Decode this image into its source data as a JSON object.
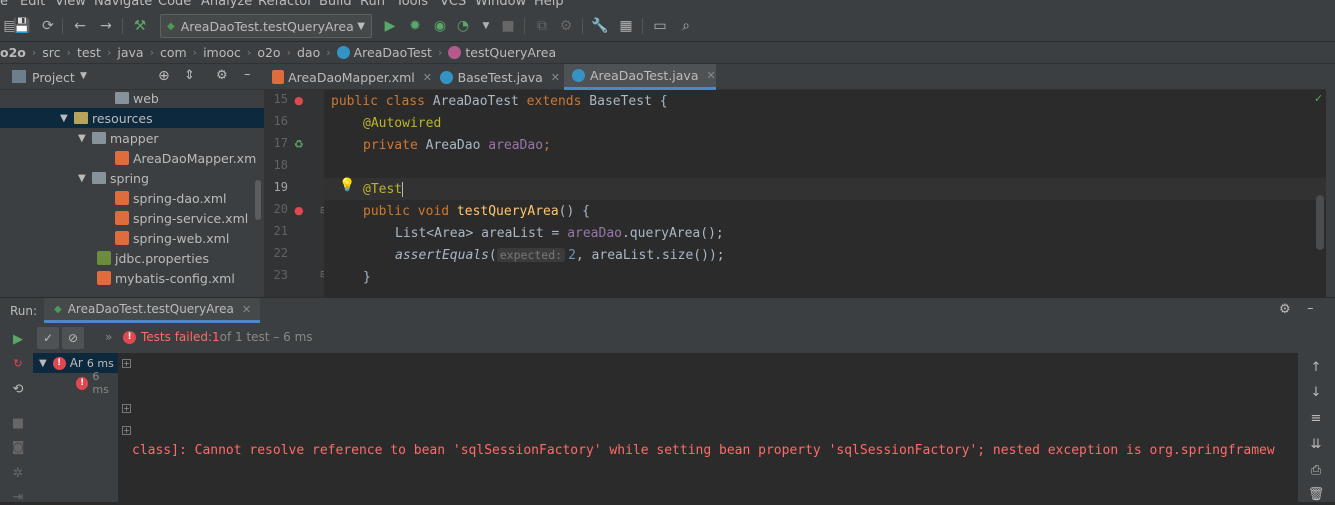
{
  "menu": [
    "e",
    "Edit",
    "View",
    "Navigate",
    "Code",
    "Analyze",
    "Refactor",
    "Build",
    "Run",
    "Tools",
    "VCS",
    "Window",
    "Help"
  ],
  "toolbar": {
    "run_config": "AreaDaoTest.testQueryArea"
  },
  "breadcrumb": [
    "o2o",
    "src",
    "test",
    "java",
    "com",
    "imooc",
    "o2o",
    "dao",
    "AreaDaoTest",
    "testQueryArea"
  ],
  "project_panel": {
    "title": "Project",
    "items": [
      {
        "label": "web",
        "type": "folder"
      },
      {
        "label": "resources",
        "type": "folder",
        "selected": true
      },
      {
        "label": "mapper",
        "type": "folder"
      },
      {
        "label": "AreaDaoMapper.xm",
        "type": "xml"
      },
      {
        "label": "spring",
        "type": "folder"
      },
      {
        "label": "spring-dao.xml",
        "type": "xml"
      },
      {
        "label": "spring-service.xml",
        "type": "xml"
      },
      {
        "label": "spring-web.xml",
        "type": "xml"
      },
      {
        "label": "jdbc.properties",
        "type": "properties"
      },
      {
        "label": "mybatis-config.xml",
        "type": "xml"
      }
    ]
  },
  "tabs": [
    {
      "label": "AreaDaoMapper.xml",
      "active": false
    },
    {
      "label": "BaseTest.java",
      "active": false
    },
    {
      "label": "AreaDaoTest.java",
      "active": true
    }
  ],
  "editor": {
    "line_numbers": [
      "15",
      "16",
      "17",
      "18",
      "19",
      "20",
      "21",
      "22",
      "23"
    ],
    "lines": {
      "l15": {
        "kw1": "public class ",
        "cls": "AreaDaoTest ",
        "kw2": "extends ",
        "base": "BaseTest {"
      },
      "l16": {
        "ann": "@Autowired"
      },
      "l17": {
        "kw": "private ",
        "type": "AreaDao ",
        "field": "areaDao",
        "end": ";"
      },
      "l19": {
        "ann": "@Test"
      },
      "l20": {
        "kw": "public void ",
        "fn": "testQueryArea",
        "end": "() {"
      },
      "l21": {
        "a": "List<Area> areaList = ",
        "field": "areaDao",
        "b": ".queryArea();"
      },
      "l22": {
        "fn": "assertEquals",
        "open": "(",
        "hint": "expected:",
        "num": "2",
        "b": ", areaList.size());"
      },
      "l23": {
        "close": "}"
      }
    }
  },
  "run_panel": {
    "label": "Run:",
    "tab": "AreaDaoTest.testQueryArea",
    "status_prefix": "Tests failed: ",
    "failed_count": "1",
    "status_suffix": " of 1 test – 6 ms",
    "tree": [
      {
        "label": "Ar",
        "time": "6 ms"
      },
      {
        "label": "",
        "time": "6 ms"
      }
    ],
    "console_error": "class]: Cannot resolve reference to bean 'sqlSessionFactory' while setting bean property 'sqlSessionFactory'; nested exception is org.springframew"
  }
}
